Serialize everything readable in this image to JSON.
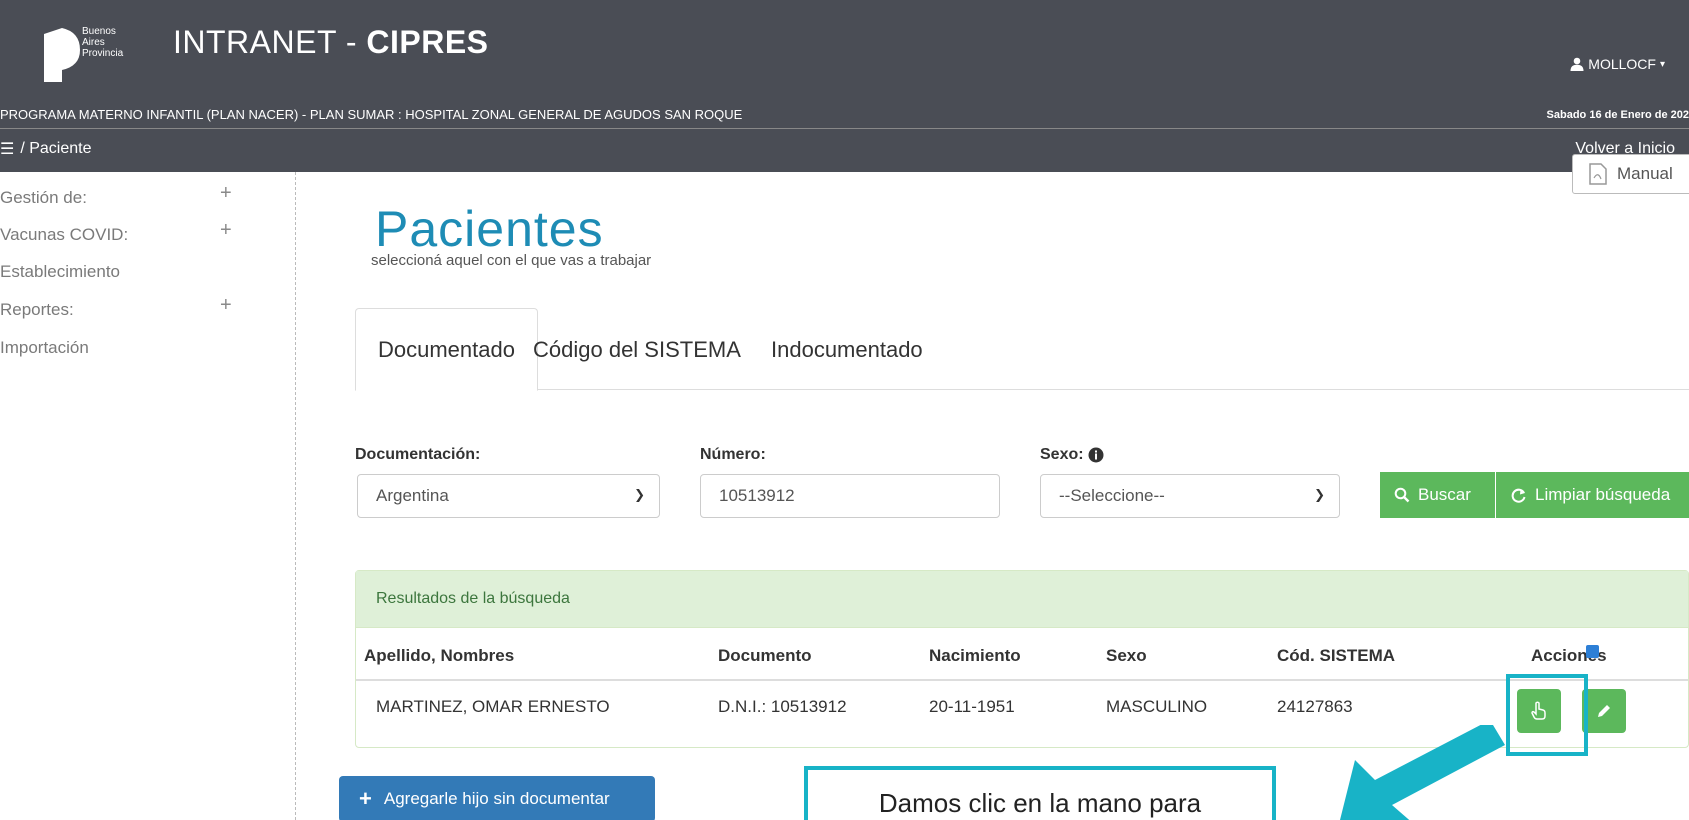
{
  "header": {
    "logo_lines": [
      "Buenos",
      "Aires",
      "Provincia"
    ],
    "app_title_prefix": "INTRANET - ",
    "app_title_strong": "CIPRES",
    "user": "MOLLOCF",
    "program": "PROGRAMA MATERNO INFANTIL (PLAN NACER) - PLAN SUMAR : HOSPITAL ZONAL GENERAL DE AGUDOS SAN ROQUE",
    "date": "Sabado 16 de Enero de 202",
    "breadcrumb": "/ Paciente",
    "back_link": "Volver a Inicio"
  },
  "sidebar": {
    "items": [
      {
        "label": "Gestión de:",
        "expand": "+"
      },
      {
        "label": "Vacunas COVID:",
        "expand": "+"
      },
      {
        "label": "Establecimiento",
        "expand": ""
      },
      {
        "label": "Reportes:",
        "expand": "+"
      },
      {
        "label": "Importación",
        "expand": ""
      }
    ]
  },
  "main": {
    "manual_label": "Manual",
    "title": "Pacientes",
    "subtitle": "seleccioná aquel con el que vas a trabajar",
    "tabs": [
      {
        "label": "Documentado",
        "active": true
      },
      {
        "label": "Código del SISTEMA",
        "active": false
      },
      {
        "label": "Indocumentado",
        "active": false
      }
    ],
    "form": {
      "doc_label": "Documentación:",
      "doc_value": "Argentina",
      "num_label": "Número:",
      "num_value": "10513912",
      "sex_label": "Sexo:",
      "sex_value": "--Seleccione--",
      "search_label": "Buscar",
      "clear_label": "Limpiar búsqueda"
    },
    "results": {
      "heading": "Resultados de la búsqueda",
      "columns": [
        "Apellido, Nombres",
        "Documento",
        "Nacimiento",
        "Sexo",
        "Cód. SISTEMA",
        "Acciones"
      ],
      "rows": [
        [
          "MARTINEZ, OMAR ERNESTO",
          "D.N.I.: 10513912",
          "20-11-1951",
          "MASCULINO",
          "24127863"
        ]
      ]
    },
    "add_child_label": "Agregarle hijo sin documentar"
  },
  "annotation": {
    "callout_text": "Damos clic en la mano para",
    "accent_color": "#18b3c7"
  }
}
